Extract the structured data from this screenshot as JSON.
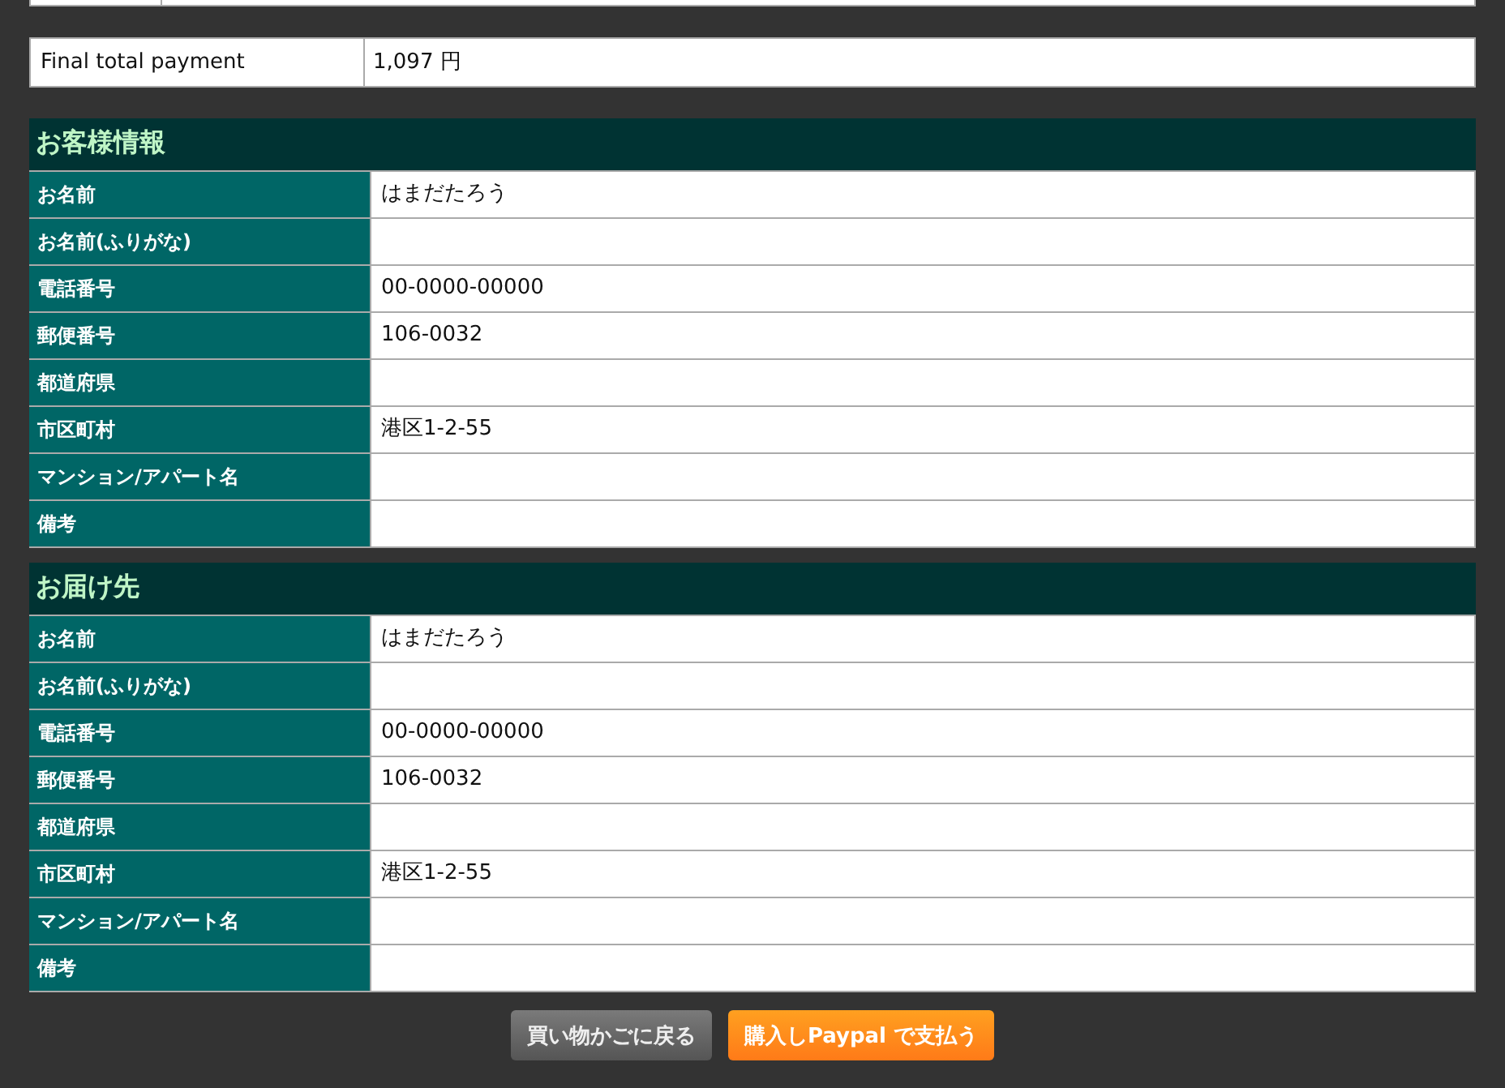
{
  "total": {
    "label": "Final total payment",
    "value": "1,097 円"
  },
  "sections": [
    {
      "title": "お客様情報",
      "rows": [
        {
          "label": "お名前",
          "value": "はまだたろう"
        },
        {
          "label": "お名前(ふりがな)",
          "value": ""
        },
        {
          "label": "電話番号",
          "value": "00-0000-00000"
        },
        {
          "label": "郵便番号",
          "value": "106-0032"
        },
        {
          "label": "都道府県",
          "value": ""
        },
        {
          "label": "市区町村",
          "value": "港区1-2-55"
        },
        {
          "label": "マンション/アパート名",
          "value": ""
        },
        {
          "label": "備考",
          "value": ""
        }
      ]
    },
    {
      "title": "お届け先",
      "rows": [
        {
          "label": "お名前",
          "value": "はまだたろう"
        },
        {
          "label": "お名前(ふりがな)",
          "value": ""
        },
        {
          "label": "電話番号",
          "value": "00-0000-00000"
        },
        {
          "label": "郵便番号",
          "value": "106-0032"
        },
        {
          "label": "都道府県",
          "value": ""
        },
        {
          "label": "市区町村",
          "value": "港区1-2-55"
        },
        {
          "label": "マンション/アパート名",
          "value": ""
        },
        {
          "label": "備考",
          "value": ""
        }
      ]
    }
  ],
  "buttons": [
    {
      "label": "買い物かごに戻る",
      "kind": "secondary"
    },
    {
      "label": "購入しPaypal で支払う",
      "kind": "primary"
    }
  ]
}
